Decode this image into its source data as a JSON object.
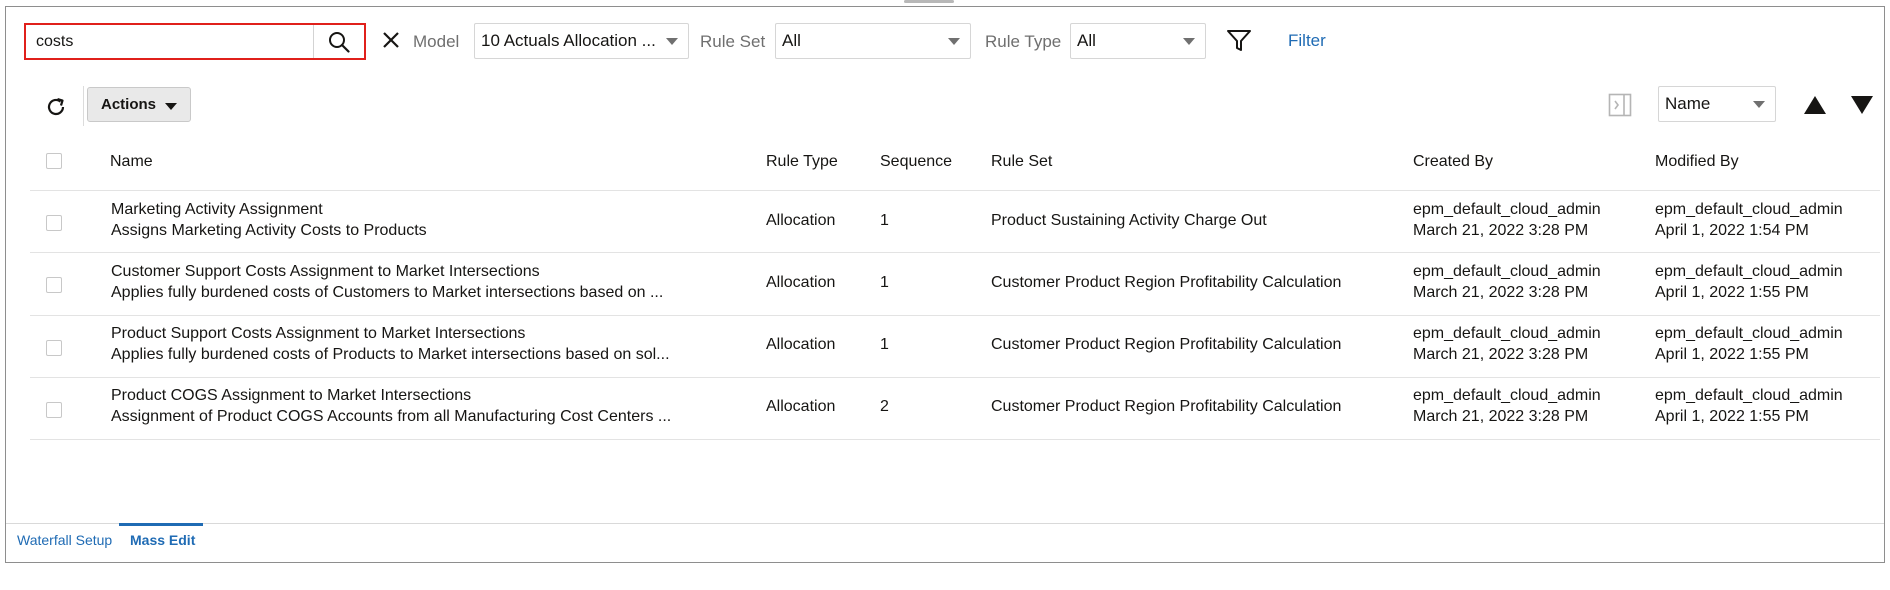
{
  "search": {
    "value": "costs"
  },
  "filters": {
    "model_label": "Model",
    "model_value": "10 Actuals Allocation ...",
    "ruleset_label": "Rule Set",
    "ruleset_value": "All",
    "ruletype_label": "Rule Type",
    "ruletype_value": "All",
    "filter_link": "Filter"
  },
  "toolbar": {
    "actions_label": "Actions",
    "sort_value": "Name"
  },
  "table": {
    "columns": [
      "Name",
      "Rule Type",
      "Sequence",
      "Rule Set",
      "Created By",
      "Modified By"
    ],
    "rows": [
      {
        "name": "Marketing Activity Assignment",
        "description": "Assigns Marketing Activity Costs to Products",
        "rule_type": "Allocation",
        "sequence": "1",
        "rule_set": "Product Sustaining Activity Charge Out",
        "created_by": "epm_default_cloud_admin",
        "created_date": "March 21, 2022 3:28 PM",
        "modified_by": "epm_default_cloud_admin",
        "modified_date": "April 1, 2022 1:54 PM"
      },
      {
        "name": "Customer Support Costs Assignment to Market Intersections",
        "description": "Applies fully burdened costs of Customers to Market intersections based on ...",
        "rule_type": "Allocation",
        "sequence": "1",
        "rule_set": "Customer Product Region Profitability Calculation",
        "created_by": "epm_default_cloud_admin",
        "created_date": "March 21, 2022 3:28 PM",
        "modified_by": "epm_default_cloud_admin",
        "modified_date": "April 1, 2022 1:55 PM"
      },
      {
        "name": "Product Support Costs Assignment to Market Intersections",
        "description": "Applies fully burdened costs of Products to Market intersections based on sol...",
        "rule_type": "Allocation",
        "sequence": "1",
        "rule_set": "Customer Product Region Profitability Calculation",
        "created_by": "epm_default_cloud_admin",
        "created_date": "March 21, 2022 3:28 PM",
        "modified_by": "epm_default_cloud_admin",
        "modified_date": "April 1, 2022 1:55 PM"
      },
      {
        "name": "Product COGS Assignment to Market Intersections",
        "description": "Assignment of Product COGS Accounts from all Manufacturing Cost Centers ...",
        "rule_type": "Allocation",
        "sequence": "2",
        "rule_set": "Customer Product Region Profitability Calculation",
        "created_by": "epm_default_cloud_admin",
        "created_date": "March 21, 2022 3:28 PM",
        "modified_by": "epm_default_cloud_admin",
        "modified_date": "April 1, 2022 1:55 PM"
      }
    ]
  },
  "tabs": [
    {
      "label": "Waterfall Setup"
    },
    {
      "label": "Mass Edit"
    }
  ],
  "colors": {
    "accent": "#1f6bb4",
    "highlight": "#e0201b"
  }
}
